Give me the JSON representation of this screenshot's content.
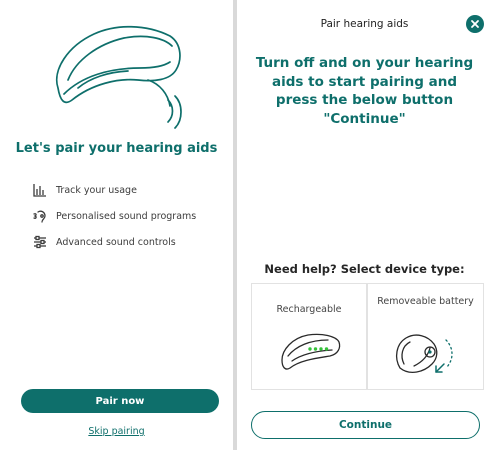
{
  "onboarding": {
    "title": "Let's pair your hearing aids",
    "features": [
      {
        "icon": "bar-chart-icon",
        "label": "Track your usage"
      },
      {
        "icon": "ear-sound-icon",
        "label": "Personalised sound programs"
      },
      {
        "icon": "sliders-icon",
        "label": "Advanced sound controls"
      }
    ],
    "pair_button": "Pair now",
    "skip_link": "Skip pairing"
  },
  "pairing": {
    "header_title": "Pair hearing aids",
    "close_icon": "close-icon",
    "instruction": "Turn off and on your hearing aids to start pairing and press the below button \"Continue\"",
    "help_title": "Need help? Select device type:",
    "device_types": [
      {
        "label": "Rechargeable",
        "icon": "rechargeable-hearing-aid-icon"
      },
      {
        "label": "Removeable battery",
        "icon": "battery-hearing-aid-icon"
      }
    ],
    "continue_button": "Continue"
  },
  "colors": {
    "brand": "#0e6f6b",
    "led": "#35c23a",
    "background": "#ffffff"
  }
}
